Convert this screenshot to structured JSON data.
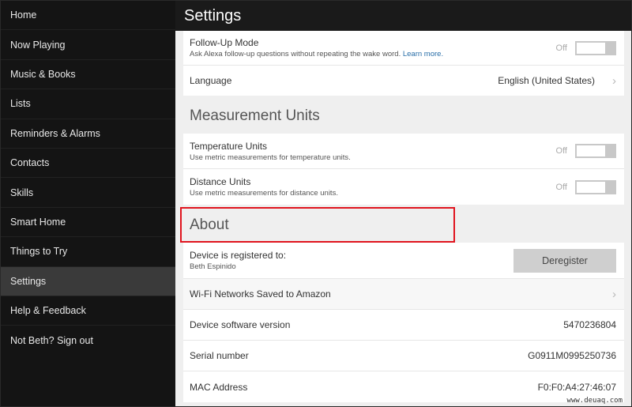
{
  "sidebar": {
    "items": [
      {
        "label": "Home"
      },
      {
        "label": "Now Playing"
      },
      {
        "label": "Music & Books"
      },
      {
        "label": "Lists"
      },
      {
        "label": "Reminders & Alarms"
      },
      {
        "label": "Contacts"
      },
      {
        "label": "Skills"
      },
      {
        "label": "Smart Home"
      },
      {
        "label": "Things to Try"
      },
      {
        "label": "Settings",
        "active": true
      },
      {
        "label": "Help & Feedback"
      },
      {
        "label": "Not Beth? Sign out"
      }
    ]
  },
  "header": {
    "title": "Settings"
  },
  "general": {
    "follow_up": {
      "title": "Follow-Up Mode",
      "subtitle": "Ask Alexa follow-up questions without repeating the wake word.",
      "link": "Learn more.",
      "state_label": "Off",
      "enabled": false
    },
    "language": {
      "title": "Language",
      "value": "English (United States)"
    }
  },
  "measurement": {
    "heading": "Measurement Units",
    "temperature": {
      "title": "Temperature Units",
      "subtitle": "Use metric measurements for temperature units.",
      "state_label": "Off",
      "enabled": false
    },
    "distance": {
      "title": "Distance Units",
      "subtitle": "Use metric measurements for distance units.",
      "state_label": "Off",
      "enabled": false
    }
  },
  "about": {
    "heading": "About",
    "registered": {
      "title": "Device is registered to:",
      "name": "Beth Espinido",
      "button": "Deregister"
    },
    "wifi": {
      "title": "Wi-Fi Networks Saved to Amazon"
    },
    "software": {
      "title": "Device software version",
      "value": "5470236804"
    },
    "serial": {
      "title": "Serial number",
      "value": "G0911M0995250736"
    },
    "mac": {
      "title": "MAC Address",
      "value": "F0:F0:A4:27:46:07"
    }
  },
  "annotation": {
    "highlight_color": "#e0141e"
  },
  "watermark": "www.deuaq.com"
}
